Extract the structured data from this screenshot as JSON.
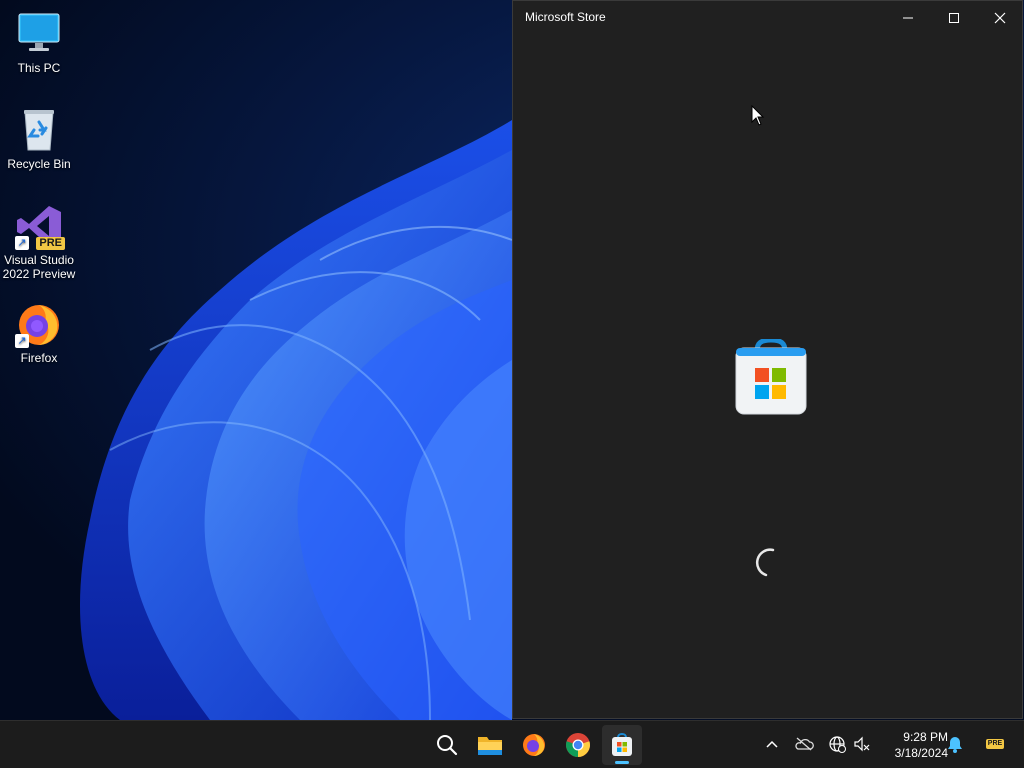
{
  "desktop": {
    "icons": [
      {
        "label": "This PC",
        "icon": "monitor-icon"
      },
      {
        "label": "Recycle Bin",
        "icon": "recycle-bin-icon"
      },
      {
        "label": "Visual Studio\n2022 Preview",
        "icon": "visual-studio-icon",
        "badge": "PRE"
      },
      {
        "label": "Firefox",
        "icon": "firefox-icon"
      }
    ]
  },
  "window": {
    "title": "Microsoft Store",
    "controls": [
      "minimize-icon",
      "maximize-icon",
      "close-icon"
    ],
    "state": "loading"
  },
  "taskbar": {
    "apps": [
      "search-icon",
      "file-explorer-icon",
      "firefox-icon",
      "chrome-icon",
      "microsoft-store-icon"
    ],
    "active_app": "microsoft-store-icon",
    "tray_icons": [
      "chevron-up-icon",
      "onedrive-offline-icon",
      "network-icon",
      "volume-muted-icon",
      "notification-bell-icon"
    ],
    "clock": {
      "time": "9:28 PM",
      "date": "3/18/2024"
    },
    "pre_badge": "PRE"
  },
  "colors": {
    "accent": "#4cc2ff",
    "window_bg": "#202020",
    "taskbar_bg": "#1c1c1c"
  }
}
